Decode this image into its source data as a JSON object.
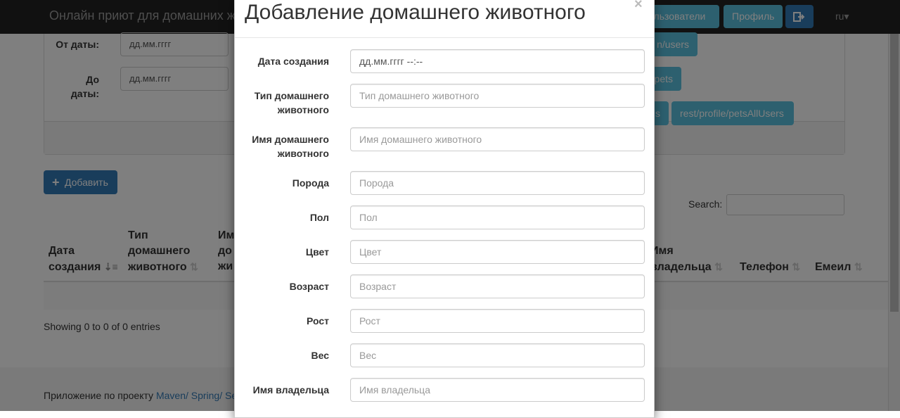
{
  "navbar": {
    "brand": "Онлайн приют для домашних ж",
    "users_label": "Пользователи",
    "profile_label": "Профиль",
    "lang": "ru▾"
  },
  "filter": {
    "from_label": "От даты:",
    "to_label_1": "До",
    "to_label_2": "даты:",
    "from_placeholder": "дд.мм.гггг",
    "to_placeholder": "дд.мм.гггг",
    "btn_users": "n/users",
    "btn_pets": "pets",
    "btn_s": "s",
    "btn_pets_all": "rest/profile/petsAllUsers"
  },
  "add_button": "Добавить",
  "search_label": "Search:",
  "table": {
    "col_date_1": "Дата",
    "col_date_2": "создания",
    "col_type_1": "Тип",
    "col_type_2": "домашнего",
    "col_type_3": "животного",
    "col_name_1": "Им",
    "col_name_2": "до",
    "col_name_3": "жи",
    "col_owner_1": "Имя",
    "col_owner_2": "владельца",
    "col_phone": "Телефон",
    "col_email": "Емеил",
    "info": "Showing 0 to 0 of 0 entries"
  },
  "footer": {
    "text": "Приложение по проекту ",
    "links": "Maven/ Spring/ Se"
  },
  "modal": {
    "title": "Добавление домашнего животного",
    "close": "×",
    "fields": [
      {
        "label_1": "Дата создания",
        "label_2": "",
        "placeholder": "дд.мм.гггг --:--"
      },
      {
        "label_1": "Тип домашнего",
        "label_2": "животного",
        "placeholder": "Тип домашнего животного"
      },
      {
        "label_1": "Имя домашнего",
        "label_2": "животного",
        "placeholder": "Имя домашнего животного"
      },
      {
        "label_1": "Порода",
        "label_2": "",
        "placeholder": "Порода"
      },
      {
        "label_1": "Пол",
        "label_2": "",
        "placeholder": "Пол"
      },
      {
        "label_1": "Цвет",
        "label_2": "",
        "placeholder": "Цвет"
      },
      {
        "label_1": "Возраст",
        "label_2": "",
        "placeholder": "Возраст"
      },
      {
        "label_1": "Рост",
        "label_2": "",
        "placeholder": "Рост"
      },
      {
        "label_1": "Вес",
        "label_2": "",
        "placeholder": "Вес"
      },
      {
        "label_1": "Имя владельца",
        "label_2": "",
        "placeholder": "Имя владельца"
      }
    ]
  },
  "colors": {
    "navbar": "#222222",
    "info_button": "#5bc0de",
    "primary_button": "#337ab7"
  }
}
